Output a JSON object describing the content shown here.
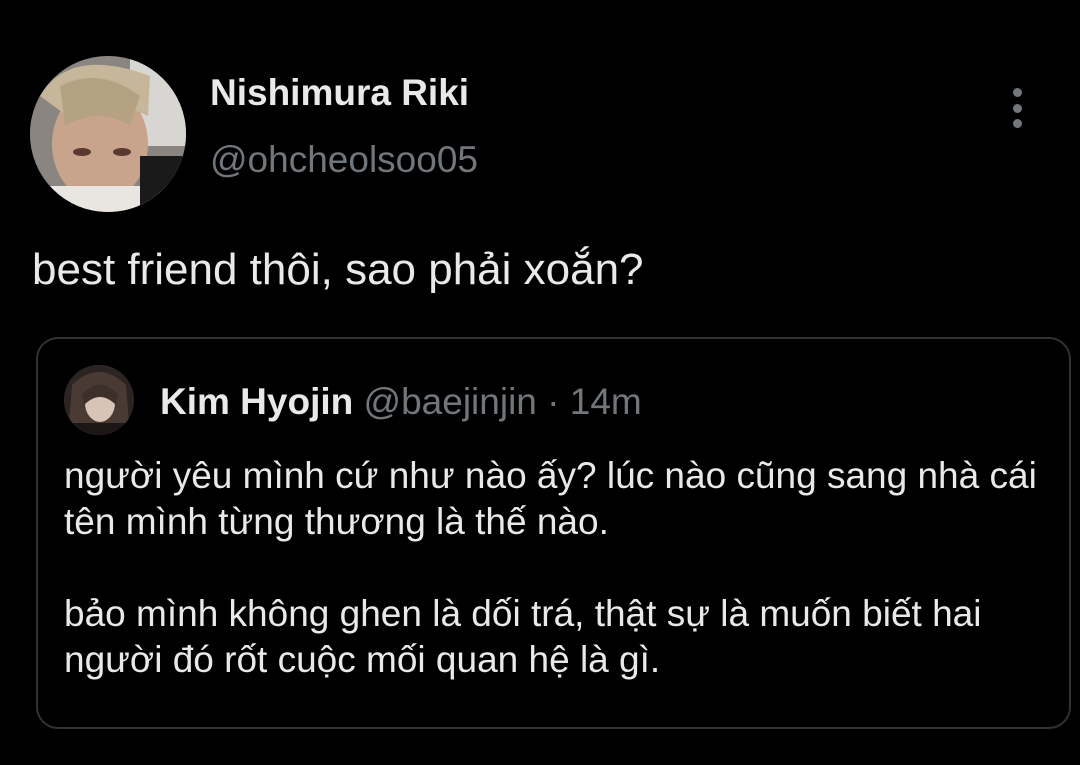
{
  "tweet": {
    "author_name": "Nishimura Riki",
    "author_handle": "@ohcheolsoo05",
    "text": "best friend thôi, sao phải xoắn?",
    "more_icon": "more-vertical-icon"
  },
  "quoted_tweet": {
    "author_name": "Kim Hyojin",
    "author_handle": "@baejinjin",
    "separator": "·",
    "time": "14m",
    "paragraphs": [
      "người yêu mình cứ như nào ấy? lúc nào cũng sang nhà cái tên mình từng thương là thế nào.",
      "bảo mình không ghen là dối trá, thật sự là muốn biết hai người đó rốt cuộc mối quan hệ là gì."
    ]
  },
  "colors": {
    "background": "#000000",
    "primary_text": "#e7e9ea",
    "secondary_text": "#71767b",
    "card_border": "#2f3336"
  }
}
